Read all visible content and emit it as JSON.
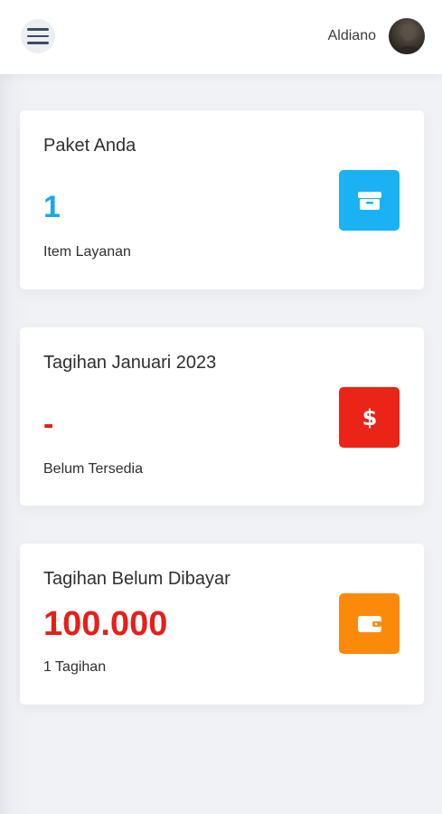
{
  "header": {
    "menu_icon": "hamburger-menu-icon",
    "username": "Aldiano",
    "avatar": "user-avatar"
  },
  "cards": [
    {
      "title": "Paket Anda",
      "value": "1",
      "subtitle": "Item Layanan",
      "value_color": "#1aa7ec",
      "icon": "box-icon",
      "icon_bg": "#1ab2f2"
    },
    {
      "title": "Tagihan Januari 2023",
      "value": "-",
      "subtitle": "Belum Tersedia",
      "value_color": "#e4201a",
      "icon": "dollar-icon",
      "icon_bg": "#ea2417"
    },
    {
      "title": "Tagihan Belum Dibayar",
      "value": "100.000",
      "subtitle": "1 Tagihan",
      "value_color": "#e4201a",
      "icon": "wallet-icon",
      "icon_bg": "#fb8a0b"
    }
  ]
}
